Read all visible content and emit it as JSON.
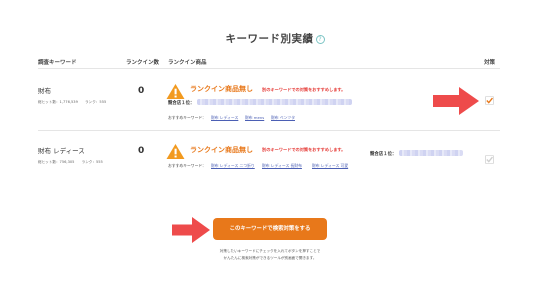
{
  "page": {
    "title": "キーワード別実績",
    "help_glyph": "?"
  },
  "table": {
    "headers": {
      "keyword": "調査キーワード",
      "rank_count": "ランクイン数",
      "rank_product": "ランクイン商品",
      "action": "対策"
    },
    "rows": [
      {
        "keyword": "財布",
        "stat_line1": "総ヒット数：1,776,539　　ランク：555",
        "rank_count": "0",
        "no_rank": "ランクイン商品無し",
        "advice": "別のキーワードでの対策をおすすめします。",
        "competitor_label": "競合店１位：",
        "suggest_label": "おすすめキーワード：",
        "suggestions": [
          "財布 レディース",
          "財布 mens",
          "財布 ベンツタ"
        ],
        "checked": true
      },
      {
        "keyword": "財布 レディース",
        "stat_line1": "総ヒット数：756,305　　ランク：555",
        "rank_count": "0",
        "no_rank": "ランクイン商品無し",
        "advice": "別のキーワードでの対策をおすすめします。",
        "competitor_label": "競合店１位：",
        "suggest_label": "おすすめキーワード：",
        "suggestions": [
          "財布 レディース 二つ折り",
          "財布 レディース 長財布",
          "財布 レディース 可愛"
        ],
        "checked": false
      }
    ]
  },
  "cta": {
    "button_label": "このキーワードで検索対策をする",
    "note_line1": "対策したいキーワードにチェックを入れてボタンを押すことで",
    "note_line2": "かんたんに検索対策ができるツールが別画面で開きます。"
  },
  "colors": {
    "accent_orange": "#e8781a",
    "alert_red": "#e53935",
    "arrow_red": "#ee4b4b",
    "link_blue": "#4b5fb4"
  },
  "icons": [
    "help-icon",
    "warning-icon",
    "checkbox-icon",
    "pointer-arrow-icon"
  ]
}
